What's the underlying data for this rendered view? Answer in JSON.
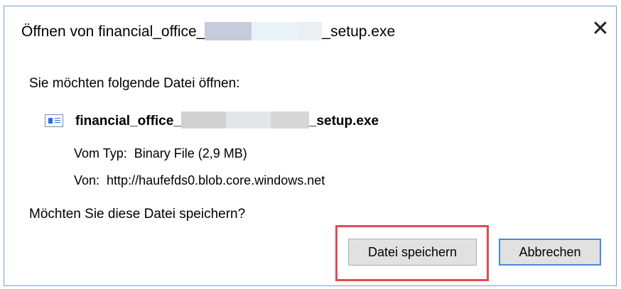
{
  "window": {
    "title_prefix": "Öffnen von financial_office_",
    "title_suffix": "_setup.exe",
    "close_glyph": "✕"
  },
  "dialog": {
    "heading": "Sie möchten folgende Datei öffnen:",
    "file": {
      "name_prefix": "financial_office_",
      "name_suffix": "_setup.exe",
      "icon": "file-icon"
    },
    "type_label": "Vom Typ:",
    "type_value": "Binary File (2,9 MB)",
    "source_label": "Von:",
    "source_value": "http://haufefds0.blob.core.windows.net",
    "question": "Möchten Sie diese Datei speichern?"
  },
  "buttons": {
    "save_label": "Datei speichern",
    "cancel_label": "Abbrechen"
  },
  "colors": {
    "highlight": "#e24a57",
    "default_button_border": "#4a87d9",
    "window_border": "#7a9fd1"
  }
}
